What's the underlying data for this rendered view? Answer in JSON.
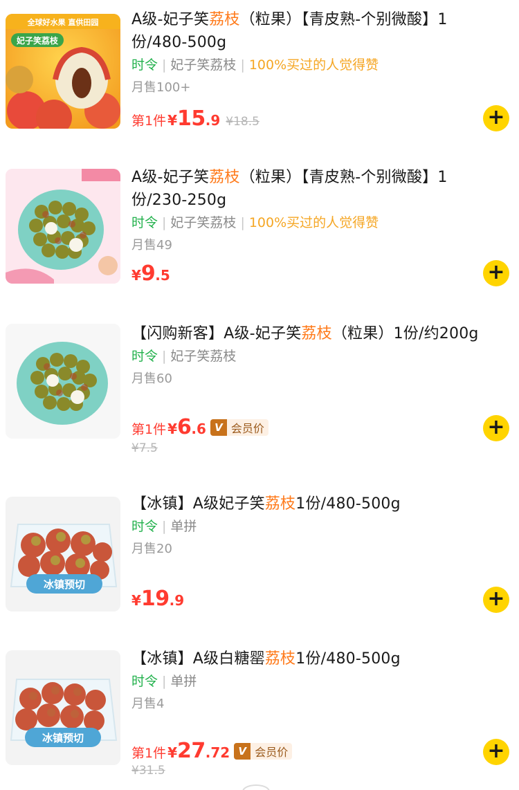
{
  "products": [
    {
      "title_pre": "A级-妃子笑",
      "title_hl": "荔枝",
      "title_post": "（粒果）【青皮熟-个别微酸】1份/480-500g",
      "tag_season": "时令",
      "tag_variety": "妃子笑荔枝",
      "tag_praise": "100%买过的人觉得赞",
      "sales": "月售100+",
      "first_piece": "第1件",
      "yen": "¥",
      "price_int": "15",
      "price_dec": ".9",
      "original_price": "¥18.5",
      "member_v": "",
      "member_label": "",
      "image_banner": "全球好水果  直供田园",
      "image_title": "妃子笑荔枝",
      "add_icon": "plus-icon"
    },
    {
      "title_pre": "A级-妃子笑",
      "title_hl": "荔枝",
      "title_post": "（粒果）【青皮熟-个别微酸】1份/230-250g",
      "tag_season": "时令",
      "tag_variety": "妃子笑荔枝",
      "tag_praise": "100%买过的人觉得赞",
      "sales": "月售49",
      "first_piece": "",
      "yen": "¥",
      "price_int": "9",
      "price_dec": ".5",
      "original_price": "",
      "member_v": "",
      "member_label": "",
      "add_icon": "plus-icon"
    },
    {
      "title_pre": "【闪购新客】A级-妃子笑",
      "title_hl": "荔枝",
      "title_post": "（粒果）1份/约200g",
      "tag_season": "时令",
      "tag_variety": "妃子笑荔枝",
      "tag_praise": "",
      "sales": "月售60",
      "first_piece": "第1件",
      "yen": "¥",
      "price_int": "6",
      "price_dec": ".6",
      "original_price": "¥7.5",
      "member_v": "V",
      "member_label": "会员价",
      "add_icon": "plus-icon"
    },
    {
      "title_pre": "【冰镇】A级妃子笑",
      "title_hl": "荔枝",
      "title_post": "1份/480-500g",
      "tag_season": "时令",
      "tag_variety": "单拼",
      "tag_praise": "",
      "sales": "月售20",
      "first_piece": "",
      "yen": "¥",
      "price_int": "19",
      "price_dec": ".9",
      "original_price": "",
      "member_v": "",
      "member_label": "",
      "image_banner": "冰镇预切",
      "add_icon": "plus-icon"
    },
    {
      "title_pre": "【冰镇】A级白糖罂",
      "title_hl": "荔枝",
      "title_post": "1份/480-500g",
      "tag_season": "时令",
      "tag_variety": "单拼",
      "tag_praise": "",
      "sales": "月售4",
      "first_piece": "第1件",
      "yen": "¥",
      "price_int": "27",
      "price_dec": ".72",
      "original_price": "¥31.5",
      "member_v": "V",
      "member_label": "会员价",
      "image_banner": "冰镇预切",
      "add_icon": "plus-icon"
    }
  ],
  "colors": {
    "highlight": "#ff7a1a",
    "price": "#ff3b30",
    "season_tag": "#22b14c",
    "praise_tag": "#f5a623",
    "add_button": "#ffd400",
    "member_badge": "#c8721b"
  }
}
